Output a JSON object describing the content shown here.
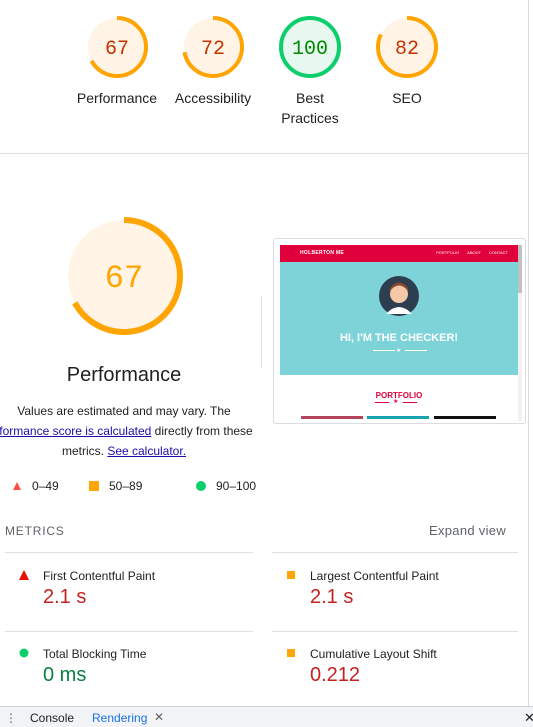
{
  "categories": [
    {
      "score": "67",
      "label": "Performance",
      "fraction": 0.67,
      "color": "#ffa400",
      "fill": "#fff4e6",
      "text": "#c33300"
    },
    {
      "score": "72",
      "label": "Accessibility",
      "fraction": 0.72,
      "color": "#ffa400",
      "fill": "#fff4e6",
      "text": "#c33300"
    },
    {
      "score": "100",
      "label_line1": "Best",
      "label_line2": "Practices",
      "fraction": 1.0,
      "color": "#0cce6b",
      "fill": "#e6f8ef",
      "text": "#008800"
    },
    {
      "score": "82",
      "label": "SEO",
      "fraction": 0.82,
      "color": "#ffa400",
      "fill": "#fff4e6",
      "text": "#c33300"
    }
  ],
  "performance": {
    "score": "67",
    "fraction": 0.67,
    "title": "Performance",
    "desc_part1": "Values are estimated and may vary. The",
    "desc_link1": "rformance score is calculated",
    "desc_part2": " directly from these",
    "desc_part3": "metrics. ",
    "desc_link2": "See calculator."
  },
  "legend": [
    {
      "range": "0–49",
      "color": "#ff4e42"
    },
    {
      "range": "50–89",
      "color": "#ffa400"
    },
    {
      "range": "90–100",
      "color": "#0cce6b"
    }
  ],
  "thumbnail": {
    "brand": "HOLBERTON ME",
    "nav": [
      "PORTFOLIO",
      "ABOUT",
      "CONTACT"
    ],
    "hero_title": "HI, I'M THE CHECKER!",
    "section_title": "PORTFOLIO"
  },
  "metrics": {
    "heading": "METRICS",
    "expand": "Expand view",
    "items": [
      {
        "label": "First Contentful Paint",
        "value": "2.1 s",
        "status": "fail",
        "color": "#c5221f"
      },
      {
        "label": "Largest Contentful Paint",
        "value": "2.1 s",
        "status": "average",
        "color": "#c5221f"
      },
      {
        "label": "Total Blocking Time",
        "value": "0 ms",
        "status": "pass",
        "color": "#0b8043"
      },
      {
        "label": "Cumulative Layout Shift",
        "value": "0.212",
        "status": "average",
        "color": "#c5221f"
      }
    ]
  },
  "drawer": {
    "menu_icon": "⋮",
    "tabs": [
      "Console",
      "Rendering"
    ],
    "close_icon": "✕"
  }
}
